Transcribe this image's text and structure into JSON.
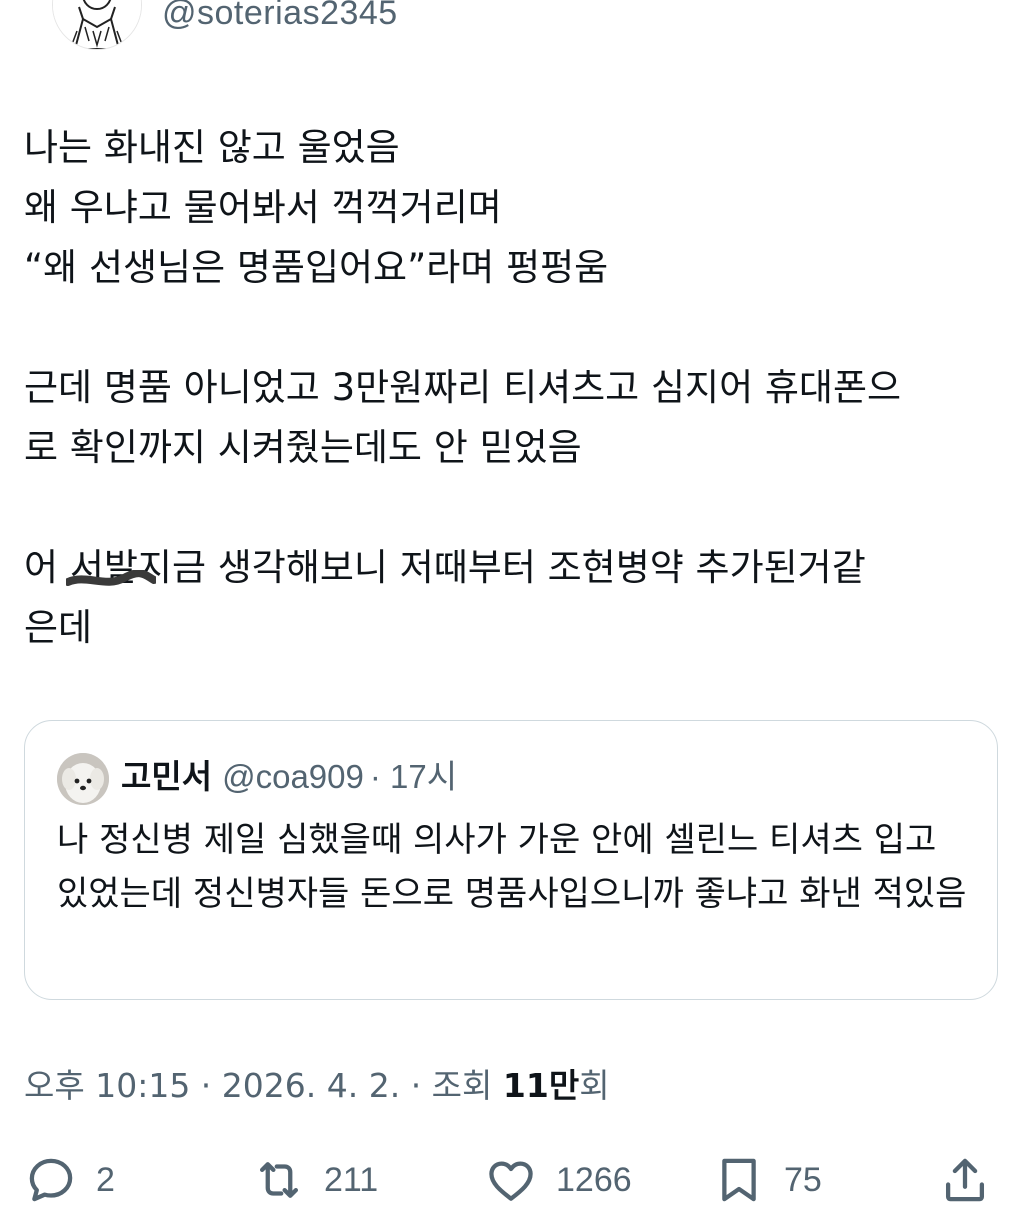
{
  "author": {
    "handle": "@soterias2345"
  },
  "tweet": {
    "lines_p1": "나는 화내진 않고 울었음\n왜 우냐고 물어봐서 꺽꺽거리며\n“왜 선생님은 명품입어요”라며 펑펑움",
    "lines_p2": "근데 명품 아니었고 3만원짜리 티셔츠고 심지어 휴대폰으\n로 확인까지 시켜줬는데도 안 믿었음",
    "p3_before": "어 ",
    "p3_scribbled": "서발",
    "p3_after": "지금 생각해보니 저때부터 조현병약 추가된거같\n은데"
  },
  "quote": {
    "name": "고민서",
    "handle": "@coa909",
    "time": "· 17시",
    "text": "나 정신병 제일 심했을때 의사가 가운 안에 셀린느 티셔츠 입고있었는데 정신병자들 돈으로 명품사입으니까 좋냐고 화낸 적있음"
  },
  "meta": {
    "time_date": "오후 10:15 · 2026. 4. 2. · 조회 ",
    "views": "11만",
    "views_suffix": "회"
  },
  "actions": {
    "replies": "2",
    "retweets": "211",
    "likes": "1266",
    "bookmarks": "75"
  },
  "colors": {
    "text": "#0f1419",
    "muted": "#536471",
    "border": "#cfd9de"
  },
  "icons": [
    "reply-icon",
    "retweet-icon",
    "like-icon",
    "bookmark-icon",
    "share-icon"
  ]
}
